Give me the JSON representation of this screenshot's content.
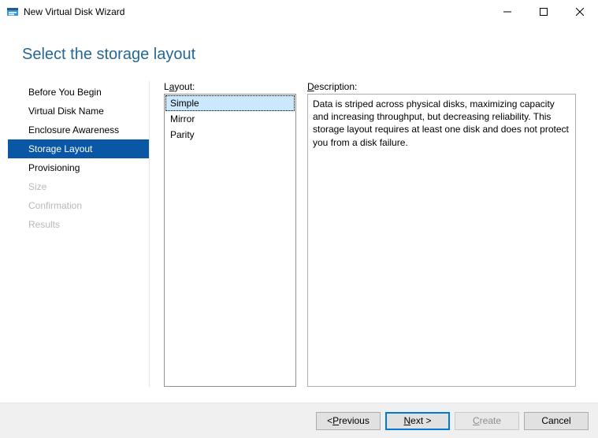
{
  "window": {
    "title": "New Virtual Disk Wizard"
  },
  "page": {
    "heading": "Select the storage layout"
  },
  "steps": [
    {
      "name": "before-you-begin",
      "label": "Before You Begin",
      "state": "done"
    },
    {
      "name": "virtual-disk-name",
      "label": "Virtual Disk Name",
      "state": "done"
    },
    {
      "name": "enclosure-awareness",
      "label": "Enclosure Awareness",
      "state": "done"
    },
    {
      "name": "storage-layout",
      "label": "Storage Layout",
      "state": "current"
    },
    {
      "name": "provisioning",
      "label": "Provisioning",
      "state": "done"
    },
    {
      "name": "size",
      "label": "Size",
      "state": "disabled"
    },
    {
      "name": "confirmation",
      "label": "Confirmation",
      "state": "disabled"
    },
    {
      "name": "results",
      "label": "Results",
      "state": "disabled"
    }
  ],
  "layout": {
    "label_pre": "L",
    "label_u": "a",
    "label_post": "yout:",
    "options": [
      {
        "name": "simple",
        "label": "Simple",
        "selected": true
      },
      {
        "name": "mirror",
        "label": "Mirror",
        "selected": false
      },
      {
        "name": "parity",
        "label": "Parity",
        "selected": false
      }
    ]
  },
  "description": {
    "label_u": "D",
    "label_post": "escription:",
    "text": "Data is striped across physical disks, maximizing capacity and increasing throughput, but decreasing reliability. This storage layout requires at least one disk and does not protect you from a disk failure."
  },
  "buttons": {
    "previous_pre": "< ",
    "previous_u": "P",
    "previous_post": "revious",
    "next_u": "N",
    "next_post": "ext >",
    "create_u": "C",
    "create_post": "reate",
    "cancel": "Cancel"
  }
}
